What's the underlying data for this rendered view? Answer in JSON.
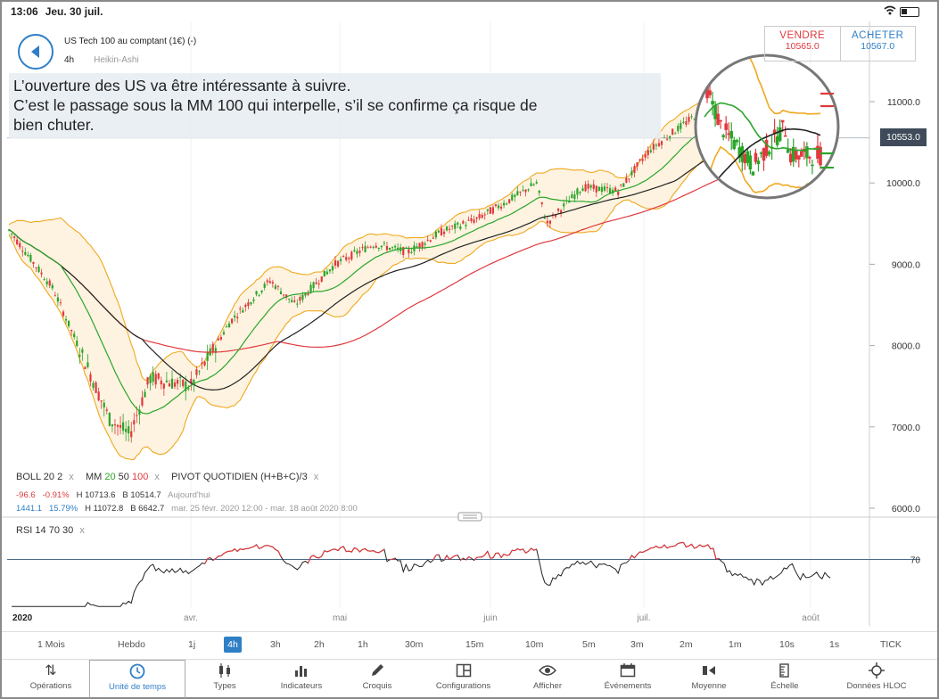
{
  "status": {
    "time": "13:06",
    "date": "Jeu. 30 juil."
  },
  "instrument": {
    "name": "US Tech 100 au comptant (1€) (-)",
    "interval": "4h",
    "chart_kind": "Heikin-Ashi"
  },
  "trade": {
    "sell_label": "VENDRE",
    "sell_price": "10565.0",
    "buy_label": "ACHETER",
    "buy_price": "10567.0"
  },
  "comment": {
    "line1": "L’ouverture des US va être intéressante à suivre.",
    "line2": "C’est le passage sous la MM 100 qui interpelle, s’il se confirme ça risque de",
    "line3": "bien chuter."
  },
  "current_price": "10553.0",
  "legend": {
    "boll": "BOLL",
    "boll_p1": "20",
    "boll_p2": "2",
    "mm": "MM",
    "mm_20": "20",
    "mm_50": "50",
    "mm_100": "100",
    "pivot": "PIVOT",
    "pivot_mode": "QUOTIDIEN",
    "pivot_formula": "(H+B+C)/3",
    "close": "x",
    "row1_change": "-96.6",
    "row1_pct": "-0.91%",
    "row1_high": "H 10713.6",
    "row1_low": "B 10514.7",
    "row1_period": "Aujourd'hui",
    "row2_change": "1441.1",
    "row2_pct": "15.79%",
    "row2_high": "H 11072.8",
    "row2_low": "B 6642.7",
    "row2_period": "mar. 25 févr. 2020 12:00 - mar. 18 août 2020 8:00"
  },
  "rsi_legend": {
    "name": "RSI",
    "p1": "14",
    "p2": "70",
    "p3": "30"
  },
  "colors": {
    "up": "#2aa52a",
    "down": "#e0393e",
    "accent": "#2f7fc6",
    "ma20": "#2aa52a",
    "ma50": "#222222",
    "ma100": "#e0393e",
    "boll": "#f0a820"
  },
  "chart_data": {
    "type": "candlestick",
    "y_axis_ticks": [
      "11000.0",
      "10000.0",
      "9000.0",
      "8000.0",
      "7000.0",
      "6000.0"
    ],
    "ylim": [
      6000,
      11300
    ],
    "x_axis_labels": [
      "2020",
      "avr.",
      "mai",
      "juin",
      "juil.",
      "août"
    ],
    "approx_close_path": [
      {
        "x": "2020-02-25",
        "y": 9450
      },
      {
        "x": "2020-03-05",
        "y": 8700
      },
      {
        "x": "2020-03-12",
        "y": 7700
      },
      {
        "x": "2020-03-16",
        "y": 7100
      },
      {
        "x": "2020-03-20",
        "y": 6900
      },
      {
        "x": "2020-03-24",
        "y": 7600
      },
      {
        "x": "2020-04-01",
        "y": 7500
      },
      {
        "x": "2020-04-09",
        "y": 8300
      },
      {
        "x": "2020-04-17",
        "y": 8800
      },
      {
        "x": "2020-04-22",
        "y": 8500
      },
      {
        "x": "2020-04-30",
        "y": 9000
      },
      {
        "x": "2020-05-08",
        "y": 9250
      },
      {
        "x": "2020-05-15",
        "y": 9150
      },
      {
        "x": "2020-05-22",
        "y": 9400
      },
      {
        "x": "2020-05-29",
        "y": 9550
      },
      {
        "x": "2020-06-05",
        "y": 9800
      },
      {
        "x": "2020-06-10",
        "y": 10000
      },
      {
        "x": "2020-06-12",
        "y": 9500
      },
      {
        "x": "2020-06-19",
        "y": 9950
      },
      {
        "x": "2020-06-26",
        "y": 9900
      },
      {
        "x": "2020-07-02",
        "y": 10400
      },
      {
        "x": "2020-07-10",
        "y": 10800
      },
      {
        "x": "2020-07-13",
        "y": 11000
      },
      {
        "x": "2020-07-17",
        "y": 10700
      },
      {
        "x": "2020-07-23",
        "y": 10500
      },
      {
        "x": "2020-07-29",
        "y": 10700
      },
      {
        "x": "2020-07-30",
        "y": 10553
      }
    ],
    "rsi": {
      "levels": [
        70
      ],
      "ylim": [
        0,
        100
      ]
    }
  },
  "timeframes": [
    "1 Mois",
    "Hebdo",
    "1j",
    "4h",
    "3h",
    "2h",
    "1h",
    "30m",
    "15m",
    "10m",
    "5m",
    "3m",
    "2m",
    "1m",
    "10s",
    "1s",
    "TICK"
  ],
  "active_timeframe": "4h",
  "tabs": [
    "Opérations",
    "Unité de temps",
    "Types",
    "Indicateurs",
    "Croquis",
    "Configurations",
    "Afficher",
    "Événements",
    "Moyenne",
    "Échelle",
    "Données HLOC"
  ],
  "active_tab": "Unité de temps"
}
